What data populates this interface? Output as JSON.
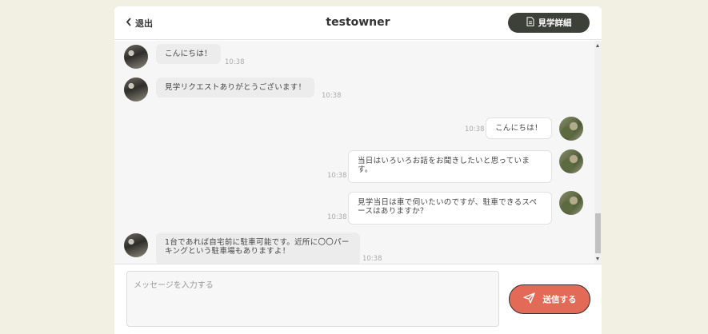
{
  "header": {
    "exit_label": "退出",
    "title": "testowner",
    "detail_label": "見学詳細"
  },
  "messages": [
    {
      "side": "left",
      "text": "こんにちは！",
      "time": "10:38"
    },
    {
      "side": "left",
      "text": "見学リクエストありがとうございます！",
      "time": "10:38"
    },
    {
      "side": "right",
      "text": "こんにちは！",
      "time": "10:38"
    },
    {
      "side": "right",
      "text": "当日はいろいろお話をお聞きしたいと思っています。",
      "time": "10:38"
    },
    {
      "side": "right",
      "text": "見学当日は車で伺いたいのですが、駐車できるスペースはありますか？",
      "time": "10:38"
    },
    {
      "side": "left",
      "text": "1台であれば自宅前に駐車可能です。近所に〇〇パーキングという駐車場もありますよ！",
      "time": "10:38"
    }
  ],
  "composer": {
    "placeholder": "メッセージを入力する",
    "send_label": "送信する"
  },
  "colors": {
    "page_bg": "#f2f0e3",
    "detail_button": "#3d4039",
    "send_button": "#e36a57"
  }
}
